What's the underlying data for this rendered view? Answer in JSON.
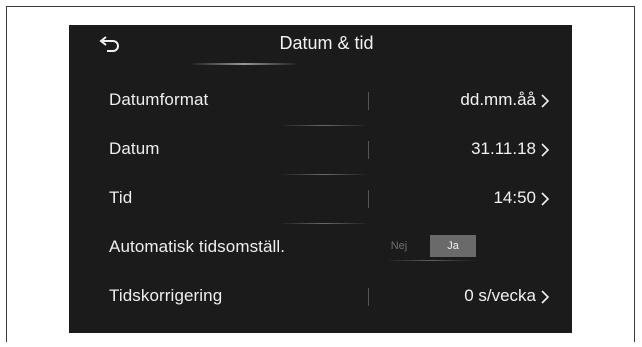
{
  "header": {
    "title": "Datum & tid",
    "back_icon": "back-arrow-icon"
  },
  "settings": [
    {
      "label": "Datumformat",
      "value": "dd.mm.åå",
      "icon": "chevron-right-icon"
    },
    {
      "label": "Datum",
      "value": "31.11.18",
      "icon": "chevron-right-icon"
    },
    {
      "label": "Tid",
      "value": "14:50",
      "icon": "chevron-right-icon"
    },
    {
      "label": "Automatisk tidsomställ.",
      "toggle": {
        "off_label": "Nej",
        "on_label": "Ja",
        "selected": "Ja"
      }
    },
    {
      "label": "Tidskorrigering",
      "value": "0 s/vecka",
      "icon": "chevron-right-icon"
    }
  ],
  "colors": {
    "screen_background": "#1b1b1b",
    "text": "#eeeeee",
    "toggle_selected": "#6a6a6a"
  }
}
